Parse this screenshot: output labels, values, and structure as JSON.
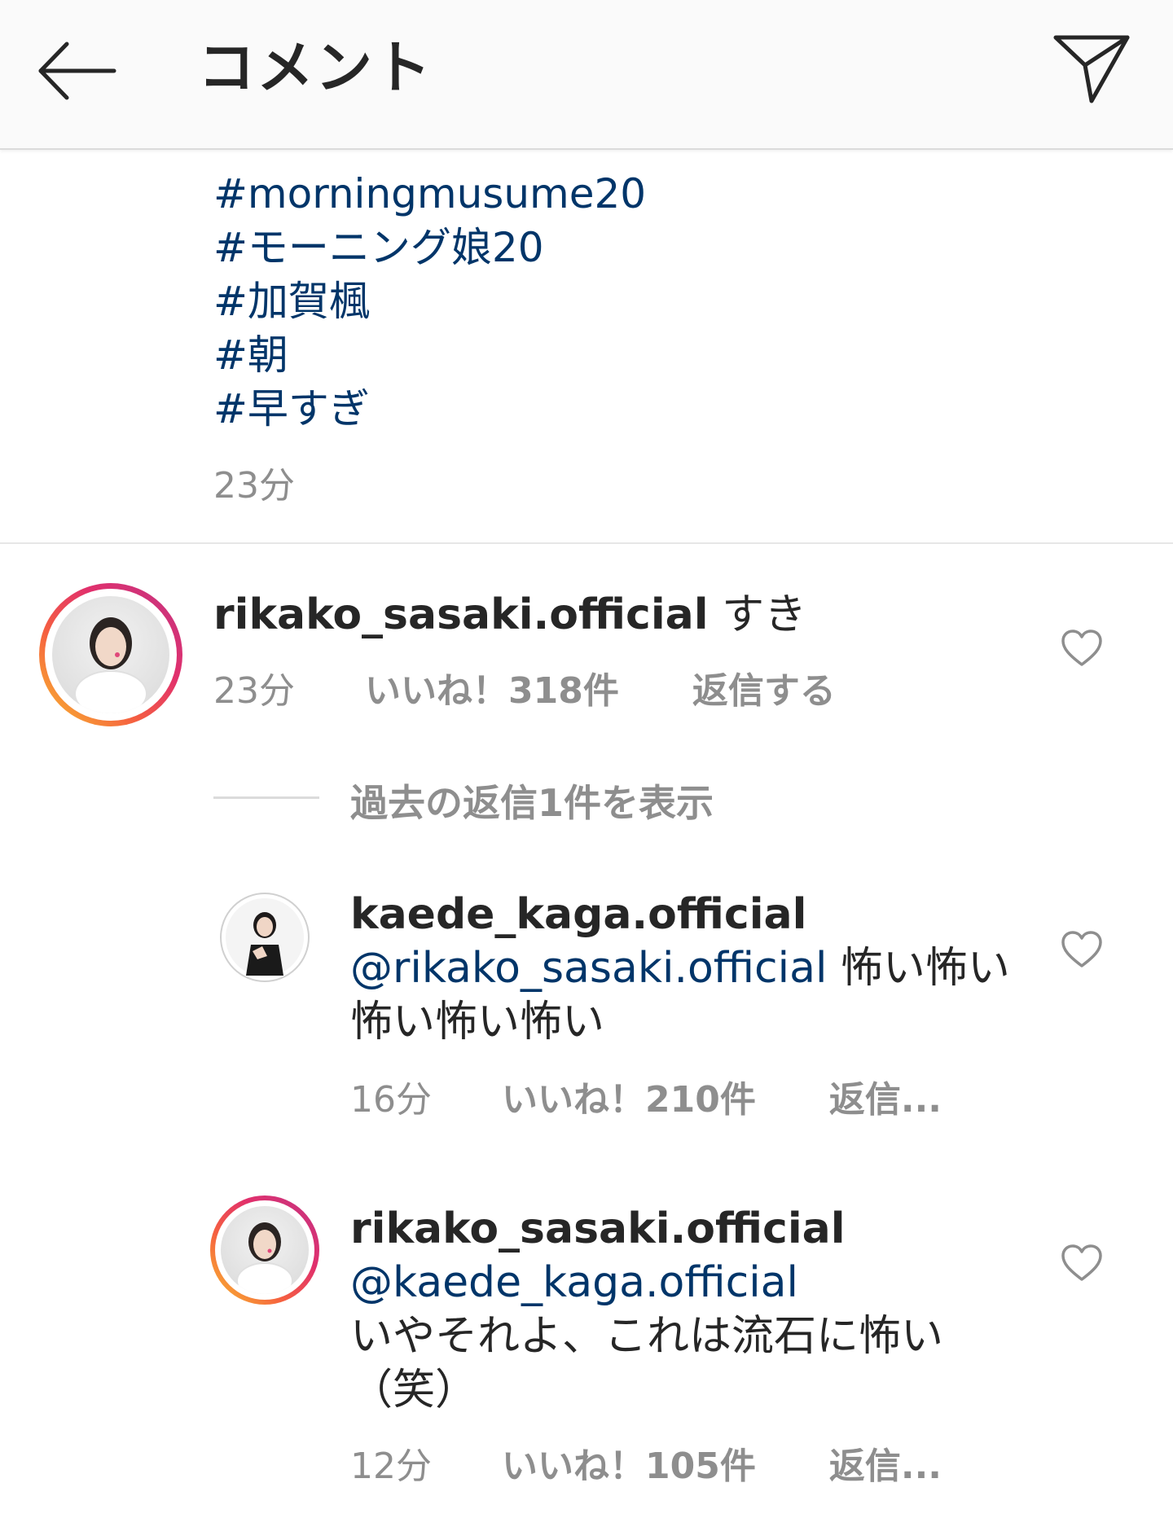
{
  "header": {
    "title": "コメント",
    "back_icon": "arrow-left-icon",
    "send_icon": "paper-plane-icon"
  },
  "caption": {
    "hashtags": [
      "#morningmusume20",
      "#モーニング娘20",
      "#加賀楓",
      "#朝",
      "#早すぎ"
    ],
    "time": "23分"
  },
  "comments": [
    {
      "username": "rikako_sasaki.official",
      "text": " すき",
      "time": "23分",
      "likes": "いいね！318件",
      "reply": "返信する"
    }
  ],
  "view_replies": "過去の返信1件を表示",
  "replies": [
    {
      "username": "kaede_kaga.official",
      "mention": "@rikako_sasaki.official",
      "text_line1": " 怖い怖い",
      "text_line2": "怖い怖い怖い",
      "time": "16分",
      "likes": "いいね！210件",
      "reply": "返信..."
    },
    {
      "username": "rikako_sasaki.official",
      "mention": "@kaede_kaga.official",
      "text_line1": " いやそれよ、これは流石に怖い",
      "text_line2": "（笑）",
      "time": "12分",
      "likes": "いいね！105件",
      "reply": "返信..."
    }
  ],
  "colors": {
    "link": "#003569",
    "secondary": "#8e8e8e",
    "primary": "#262626"
  }
}
